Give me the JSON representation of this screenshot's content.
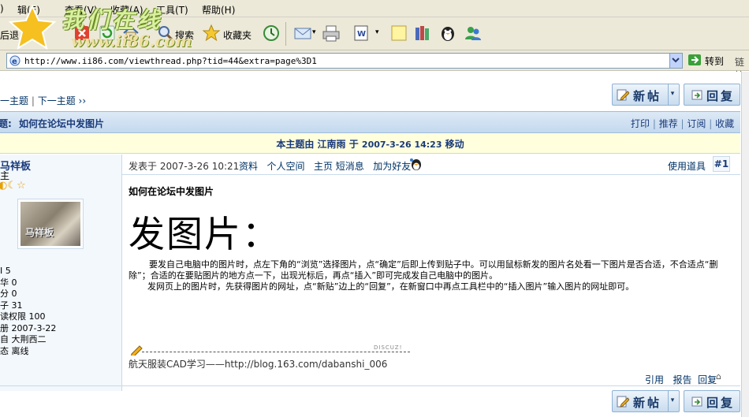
{
  "menu": [
    "辑(E)",
    "查看(V)",
    "收藏(A)",
    "工具(T)",
    "帮助(H)"
  ],
  "toolbar": {
    "back_label": "后退",
    "search_label": "搜索",
    "favorites_label": "收藏夹"
  },
  "logo": {
    "text": "我们在线",
    "url": "www.ii86.com"
  },
  "address": {
    "url": "http://www.ii86.com/viewthread.php?tid=44&extra=page%3D1",
    "go_label": "转到",
    "links_label": "链接"
  },
  "nav": {
    "prev": "上一主题",
    "next": "下一主题 ››"
  },
  "buttons": {
    "new_post": "新帖",
    "reply": "回复"
  },
  "thread": {
    "title_prefix": "标题:",
    "title": "如何在论坛中发图片",
    "actions": [
      "打印",
      "推荐",
      "订阅",
      "收藏"
    ],
    "move_notice_prefix": "本主题由",
    "move_notice_user": "江南雨",
    "move_notice_mid": "于",
    "move_notice_time": "2007-3-26 14:23",
    "move_notice_action": "移动"
  },
  "author": {
    "name": "马祥板",
    "group": "主",
    "stars": "◐☾☆",
    "avatar_caption": "马祥板",
    "stats": [
      {
        "label": "I",
        "value": "5"
      },
      {
        "label": "华",
        "value": "0"
      },
      {
        "label": "分",
        "value": "0"
      },
      {
        "label": "子",
        "value": "31"
      },
      {
        "label": "读权限",
        "value": "100"
      },
      {
        "label": "册",
        "value": "2007-3-22"
      },
      {
        "label": "自",
        "value": "大荆西二"
      },
      {
        "label": "态",
        "value": "离线"
      }
    ]
  },
  "post": {
    "posted": "发表于 2007-3-26 10:21",
    "links": [
      "资料",
      "个人空间",
      "主页",
      "短消息",
      "加为好友"
    ],
    "tools": "使用道具",
    "floor": "#1",
    "subject": "如何在论坛中发图片",
    "big_heading": "发图片：",
    "para1": "要发自己电脑中的图片时，点左下角的“浏览”选择图片，点“确定”后即上传到贴子中。可以用鼠标新发的图片名处看一下图片是否合适，不合适点“删除”；合适的在要贴图片的地方点一下，出现光标后，再点“插入”即可完成发自己电脑中的图片。",
    "para2": "发网页上的图片时，先获得图片的网址，点“新贴”边上的“回复”，在新窗口中再点工具栏中的“插入图片”输入图片的网址即可。",
    "sig_mark": "DISCUZ!",
    "signature": "航天服装CAD学习——http://blog.163.com/dabanshi_006",
    "footer_links": [
      "引用",
      "报告",
      "回复"
    ]
  }
}
